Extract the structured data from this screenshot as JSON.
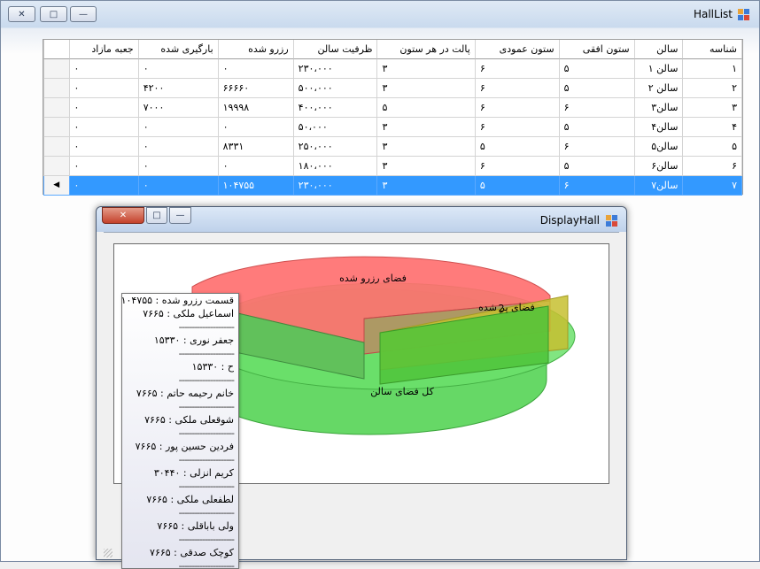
{
  "main_window": {
    "title": "HallList",
    "grid": {
      "columns": [
        "شناسه",
        "سالن",
        "ستون افقی",
        "ستون عمودی",
        "پالت در هر ستون",
        "ظرفیت سالن",
        "رزرو شده",
        "بارگیری شده",
        "جعبه مازاد"
      ],
      "rows": [
        [
          "۱",
          "سالن ۱",
          "۵",
          "۶",
          "۳",
          "۲۳۰،۰۰۰",
          "۰",
          "۰",
          "۰"
        ],
        [
          "۲",
          "سالن ۲",
          "۵",
          "۶",
          "۳",
          "۵۰۰،۰۰۰",
          "۶۶۶۶۰",
          "۴۲۰۰",
          "۰"
        ],
        [
          "۳",
          "سالن۳",
          "۶",
          "۶",
          "۵",
          "۴۰۰،۰۰۰",
          "۱۹۹۹۸",
          "۷۰۰۰",
          "۰"
        ],
        [
          "۴",
          "سالن۴",
          "۵",
          "۶",
          "۳",
          "۵۰،۰۰۰",
          "۰",
          "۰",
          "۰"
        ],
        [
          "۵",
          "سالن۵",
          "۶",
          "۵",
          "۳",
          "۲۵۰،۰۰۰",
          "۸۳۳۱",
          "۰",
          "۰"
        ],
        [
          "۶",
          "سالن۶",
          "۵",
          "۶",
          "۳",
          "۱۸۰،۰۰۰",
          "۰",
          "۰",
          "۰"
        ],
        [
          "۷",
          "سالن۷",
          "۶",
          "۵",
          "۳",
          "۲۳۰،۰۰۰",
          "۱۰۴۷۵۵",
          "۰",
          "۰"
        ]
      ],
      "selected_row": 6,
      "row_indicator": "◀"
    }
  },
  "display_window": {
    "title": "DisplayHall",
    "chart_data": {
      "type": "pie",
      "slices": [
        {
          "label": "فضای رزرو شده",
          "color": "#ff7070"
        },
        {
          "label": "فضای پر شده",
          "color": "#c7c030"
        },
        {
          "label": "کل فضای سالن",
          "color": "#5ed65e"
        }
      ],
      "overlay_text": "2"
    },
    "tooltip": {
      "header": "قسمت رزرو شده : ۱۰۴۷۵۵",
      "separator": "---------------------",
      "entries": [
        "اسماعیل ملکی : ۷۶۶۵",
        "جعفر نوری : ۱۵۳۳۰",
        "ح : ۱۵۳۳۰",
        "خانم رحیمه حاتم : ۷۶۶۵",
        "شوقعلی ملکی : ۷۶۶۵",
        "فردین حسین پور : ۷۶۶۵",
        "کریم انزلی : ۳۰۴۴۰",
        "لطفعلی ملکی : ۷۶۶۵",
        "ولی باباقلی : ۷۶۶۵",
        "کوچک صدقی : ۷۶۶۵"
      ]
    }
  },
  "colors": {
    "selection": "#3399ff",
    "reserved": "#ff7070",
    "filled": "#c7c030",
    "total": "#5ed65e"
  }
}
